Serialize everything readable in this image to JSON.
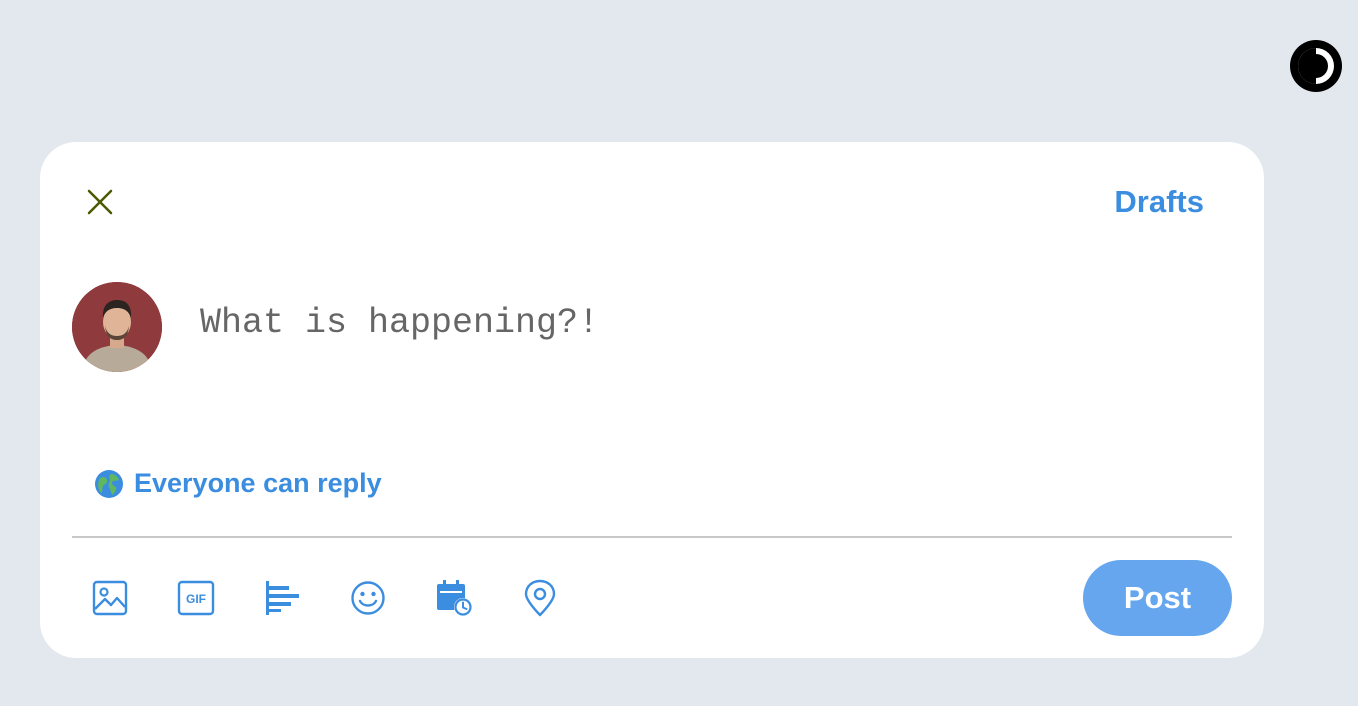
{
  "composer": {
    "drafts_label": "Drafts",
    "placeholder": "What is happening?!",
    "value": "",
    "reply_setting_label": "Everyone can reply",
    "post_label": "Post"
  },
  "toolbar": {
    "icons": [
      "image-icon",
      "gif-icon",
      "poll-icon",
      "emoji-icon",
      "schedule-icon",
      "location-icon"
    ],
    "gif_text": "GIF"
  },
  "colors": {
    "background": "#e3e8ef",
    "accent": "#3b8de0",
    "post_button": "#66a6ee",
    "close_icon": "#4a5a00"
  }
}
